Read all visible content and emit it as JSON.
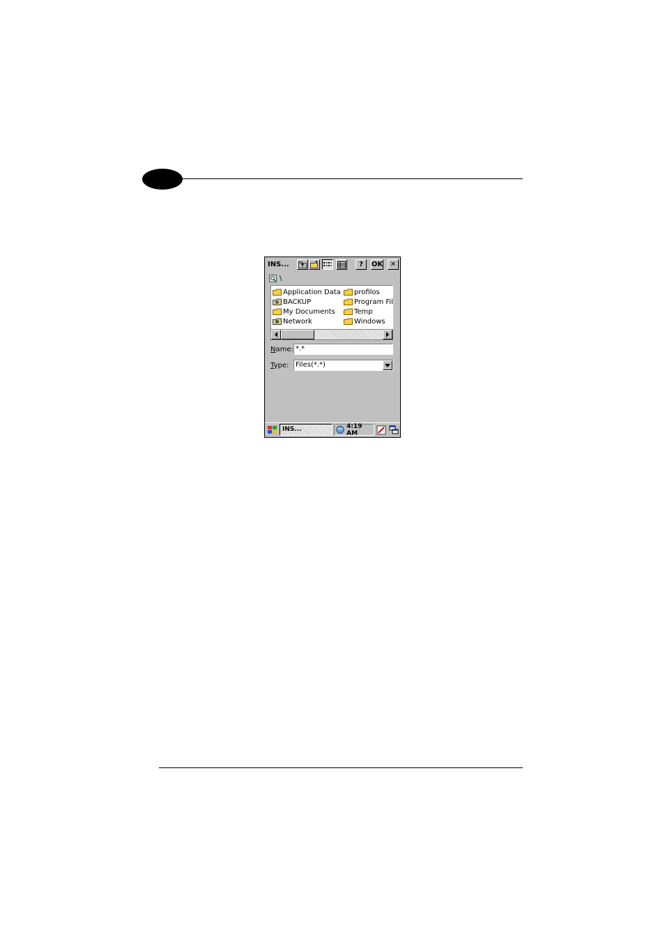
{
  "window": {
    "title": "INS...",
    "buttons": {
      "help": "?",
      "ok": "OK",
      "close": "✕"
    }
  },
  "path": {
    "current": "\\"
  },
  "files": {
    "left": [
      "Application Data",
      "BACKUP",
      "My Documents",
      "Network"
    ],
    "right": [
      "profilos",
      "Program File",
      "Temp",
      "Windows"
    ]
  },
  "form": {
    "name_label_accel": "N",
    "name_label_rest": "ame:",
    "name_value": "*.*",
    "type_label_accel": "T",
    "type_label_rest": "ype:",
    "type_value": "Files(*.*)"
  },
  "taskbar": {
    "task_label": "INS...",
    "clock": "4:19 AM"
  },
  "icons": {
    "toolbar": [
      "up-folder-icon",
      "new-folder-icon",
      "list-view-icon",
      "details-view-icon"
    ],
    "folder_color": "#f5d04a"
  }
}
